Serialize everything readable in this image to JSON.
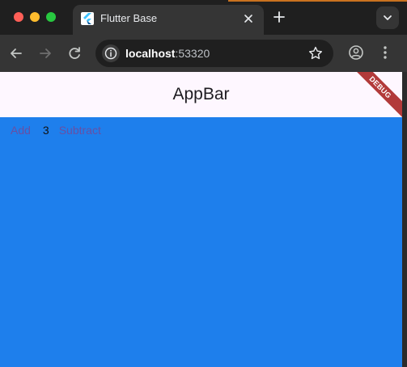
{
  "browser": {
    "tab": {
      "title": "Flutter Base",
      "favicon": "flutter-icon"
    },
    "toolbar": {
      "url_host": "localhost",
      "url_port": ":53320"
    },
    "colors": {
      "page_background": "#1e7fec",
      "appbar_background": "#fef7ff",
      "link_color": "#6750a4",
      "debug_ribbon": "#b23a3a"
    }
  },
  "app": {
    "appbar_title": "AppBar",
    "debug_banner": "DEBUG",
    "add_label": "Add",
    "count": "3",
    "subtract_label": "Subtract"
  }
}
